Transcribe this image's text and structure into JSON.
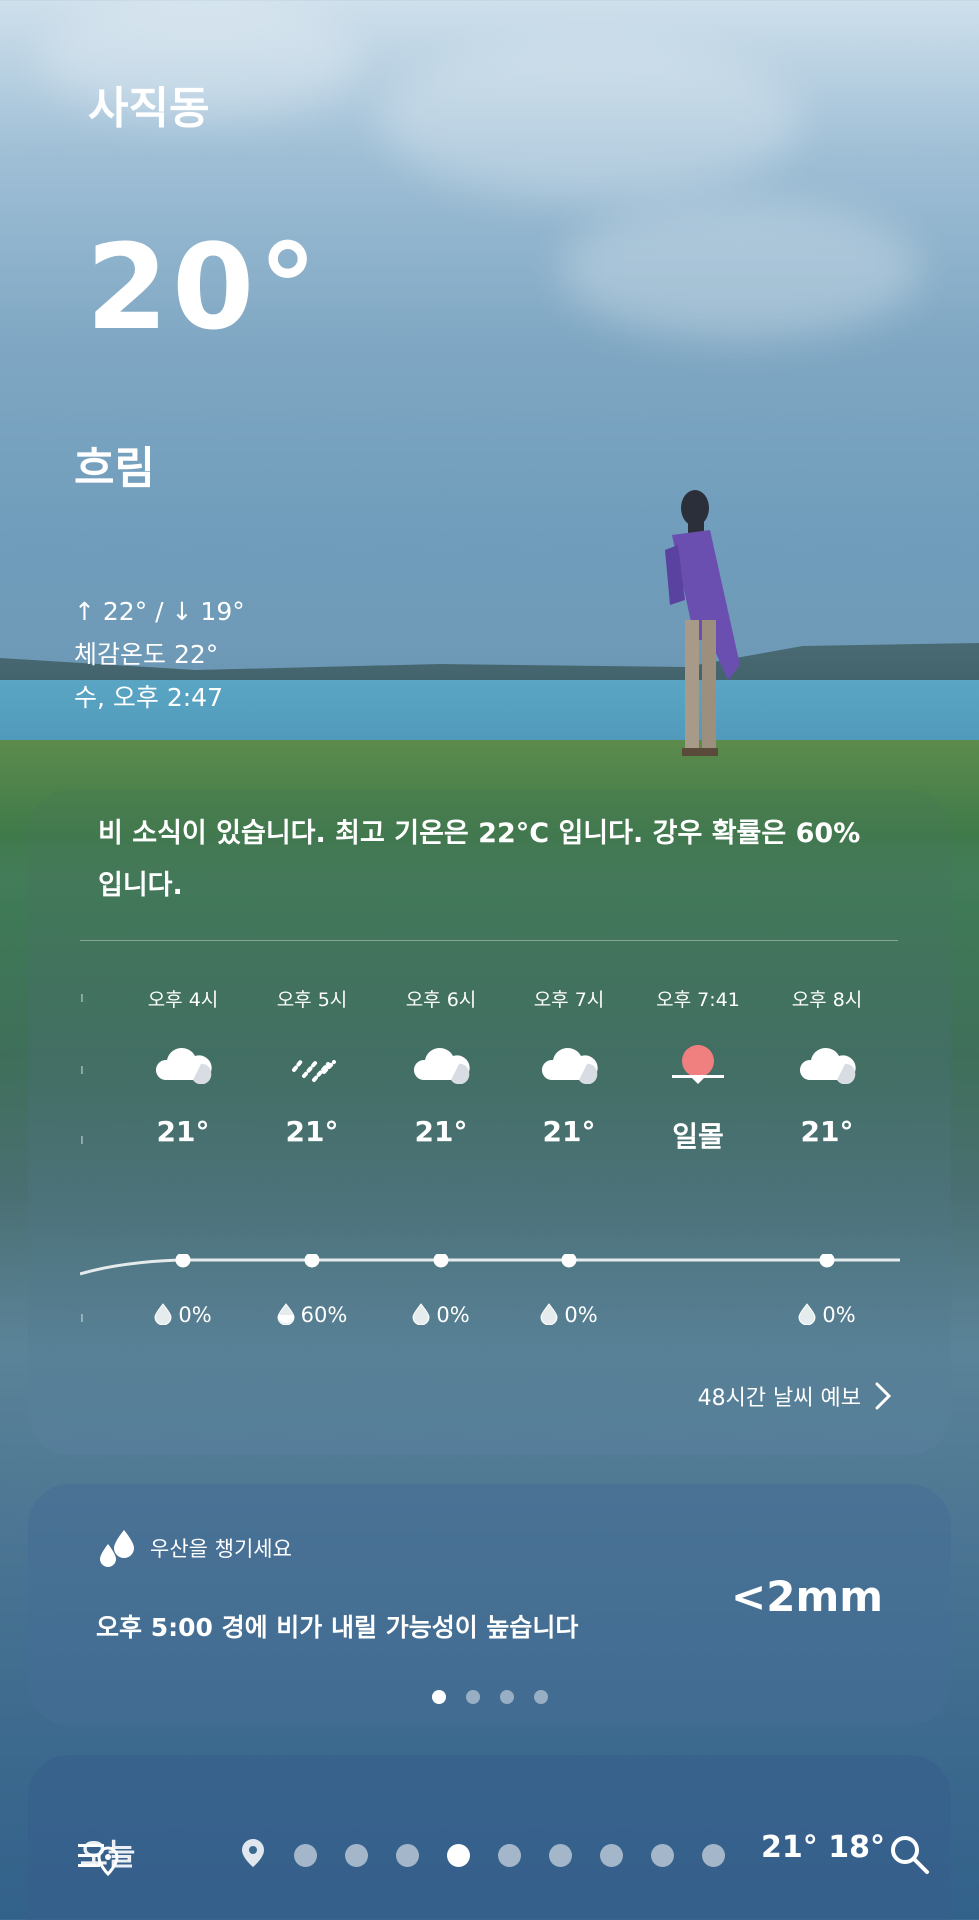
{
  "location": "사직동",
  "current": {
    "temperature": "20°",
    "condition": "흐림",
    "high_low": "↑ 22° / ↓ 19°",
    "feels_like": "체감온도 22°",
    "updated": "수, 오후 2:47"
  },
  "summary": "비 소식이 있습니다. 최고 기온은 22°C 입니다. 강우 확률은 60% 입니다.",
  "hourly": [
    {
      "time": "오후 4시",
      "icon": "cloud-icon",
      "temp": "21°",
      "pop": "0%",
      "pop_icon": "drop-empty-icon",
      "temp_value": 21
    },
    {
      "time": "오후 5시",
      "icon": "rain-icon",
      "temp": "21°",
      "pop": "60%",
      "pop_icon": "drop-half-icon",
      "temp_value": 21
    },
    {
      "time": "오후 6시",
      "icon": "cloud-icon",
      "temp": "21°",
      "pop": "0%",
      "pop_icon": "drop-empty-icon",
      "temp_value": 21
    },
    {
      "time": "오후 7시",
      "icon": "cloud-icon",
      "temp": "21°",
      "pop": "0%",
      "pop_icon": "drop-empty-icon",
      "temp_value": 21
    },
    {
      "time": "오후 7:41",
      "icon": "sunset-icon",
      "temp": "일몰",
      "pop": "",
      "pop_icon": "",
      "temp_value": null
    },
    {
      "time": "오후 8시",
      "icon": "cloud-icon",
      "temp": "21°",
      "pop": "0%",
      "pop_icon": "drop-empty-icon",
      "temp_value": 21
    }
  ],
  "forecast_link": "48시간 날씨 예보",
  "rain_card": {
    "header": "우산을 챙기세요",
    "message": "오후 5:00 경에 비가 내릴 가능성이 높습니다",
    "amount": "<2mm",
    "dots_total": 4,
    "dots_active": 0
  },
  "bottom": {
    "today_label": "오늘",
    "temps": "21° 18°",
    "page_dots_total": 9,
    "page_dots_active": 3
  },
  "colors": {
    "sunset": "#f08080",
    "text": "#ffffff"
  }
}
